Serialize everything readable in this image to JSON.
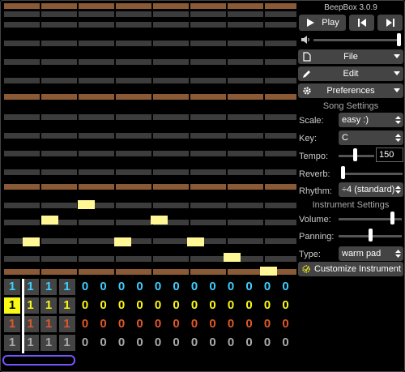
{
  "app": {
    "version": "BeepBox 3.0.9"
  },
  "colors": {
    "brown_row": "#8a5a36",
    "gray_row": "#3c3c3c",
    "note": "#fff795",
    "channel_pitch1": "#3ccfff",
    "channel_pitch2": "#f9f917",
    "channel_pitch3": "#e0582a",
    "channel_drum": "#aaaaaa",
    "selected_cell": "#f9f917",
    "loop_outline": "#7a52ff"
  },
  "transport": {
    "play_label": "Play",
    "play_icon": "play-icon",
    "prev_icon": "skip-previous-icon",
    "next_icon": "skip-next-icon",
    "volume_icon": "speaker-icon",
    "volume_level": 1.0
  },
  "menus": {
    "file": "File",
    "edit": "Edit",
    "preferences": "Preferences"
  },
  "song_settings": {
    "title": "Song Settings",
    "scale_label": "Scale:",
    "scale_value": "easy :)",
    "key_label": "Key:",
    "key_value": "C",
    "tempo_label": "Tempo:",
    "tempo_value": "150",
    "tempo_level": 0.45,
    "reverb_label": "Reverb:",
    "reverb_level": 0.0,
    "rhythm_label": "Rhythm:",
    "rhythm_value": "÷4 (standard)"
  },
  "instrument_settings": {
    "title": "Instrument Settings",
    "volume_label": "Volume:",
    "volume_level": 0.88,
    "panning_label": "Panning:",
    "panning_level": 0.5,
    "type_label": "Type:",
    "type_value": "warm pad",
    "customize_label": "Customize Instrument"
  },
  "track": {
    "channels": [
      {
        "color_key": "channel_pitch1",
        "patterns": [
          "1",
          "1",
          "1",
          "1",
          "0",
          "0",
          "0",
          "0",
          "0",
          "0",
          "0",
          "0",
          "0",
          "0",
          "0",
          "0"
        ]
      },
      {
        "color_key": "channel_pitch2",
        "patterns": [
          "1",
          "1",
          "1",
          "1",
          "0",
          "0",
          "0",
          "0",
          "0",
          "0",
          "0",
          "0",
          "0",
          "0",
          "0",
          "0"
        ]
      },
      {
        "color_key": "channel_pitch3",
        "patterns": [
          "1",
          "1",
          "1",
          "1",
          "0",
          "0",
          "0",
          "0",
          "0",
          "0",
          "0",
          "0",
          "0",
          "0",
          "0",
          "0"
        ]
      },
      {
        "color_key": "channel_drum",
        "patterns": [
          "1",
          "1",
          "1",
          "1",
          "0",
          "0",
          "0",
          "0",
          "0",
          "0",
          "0",
          "0",
          "0",
          "0",
          "0",
          "0"
        ]
      }
    ]
  }
}
